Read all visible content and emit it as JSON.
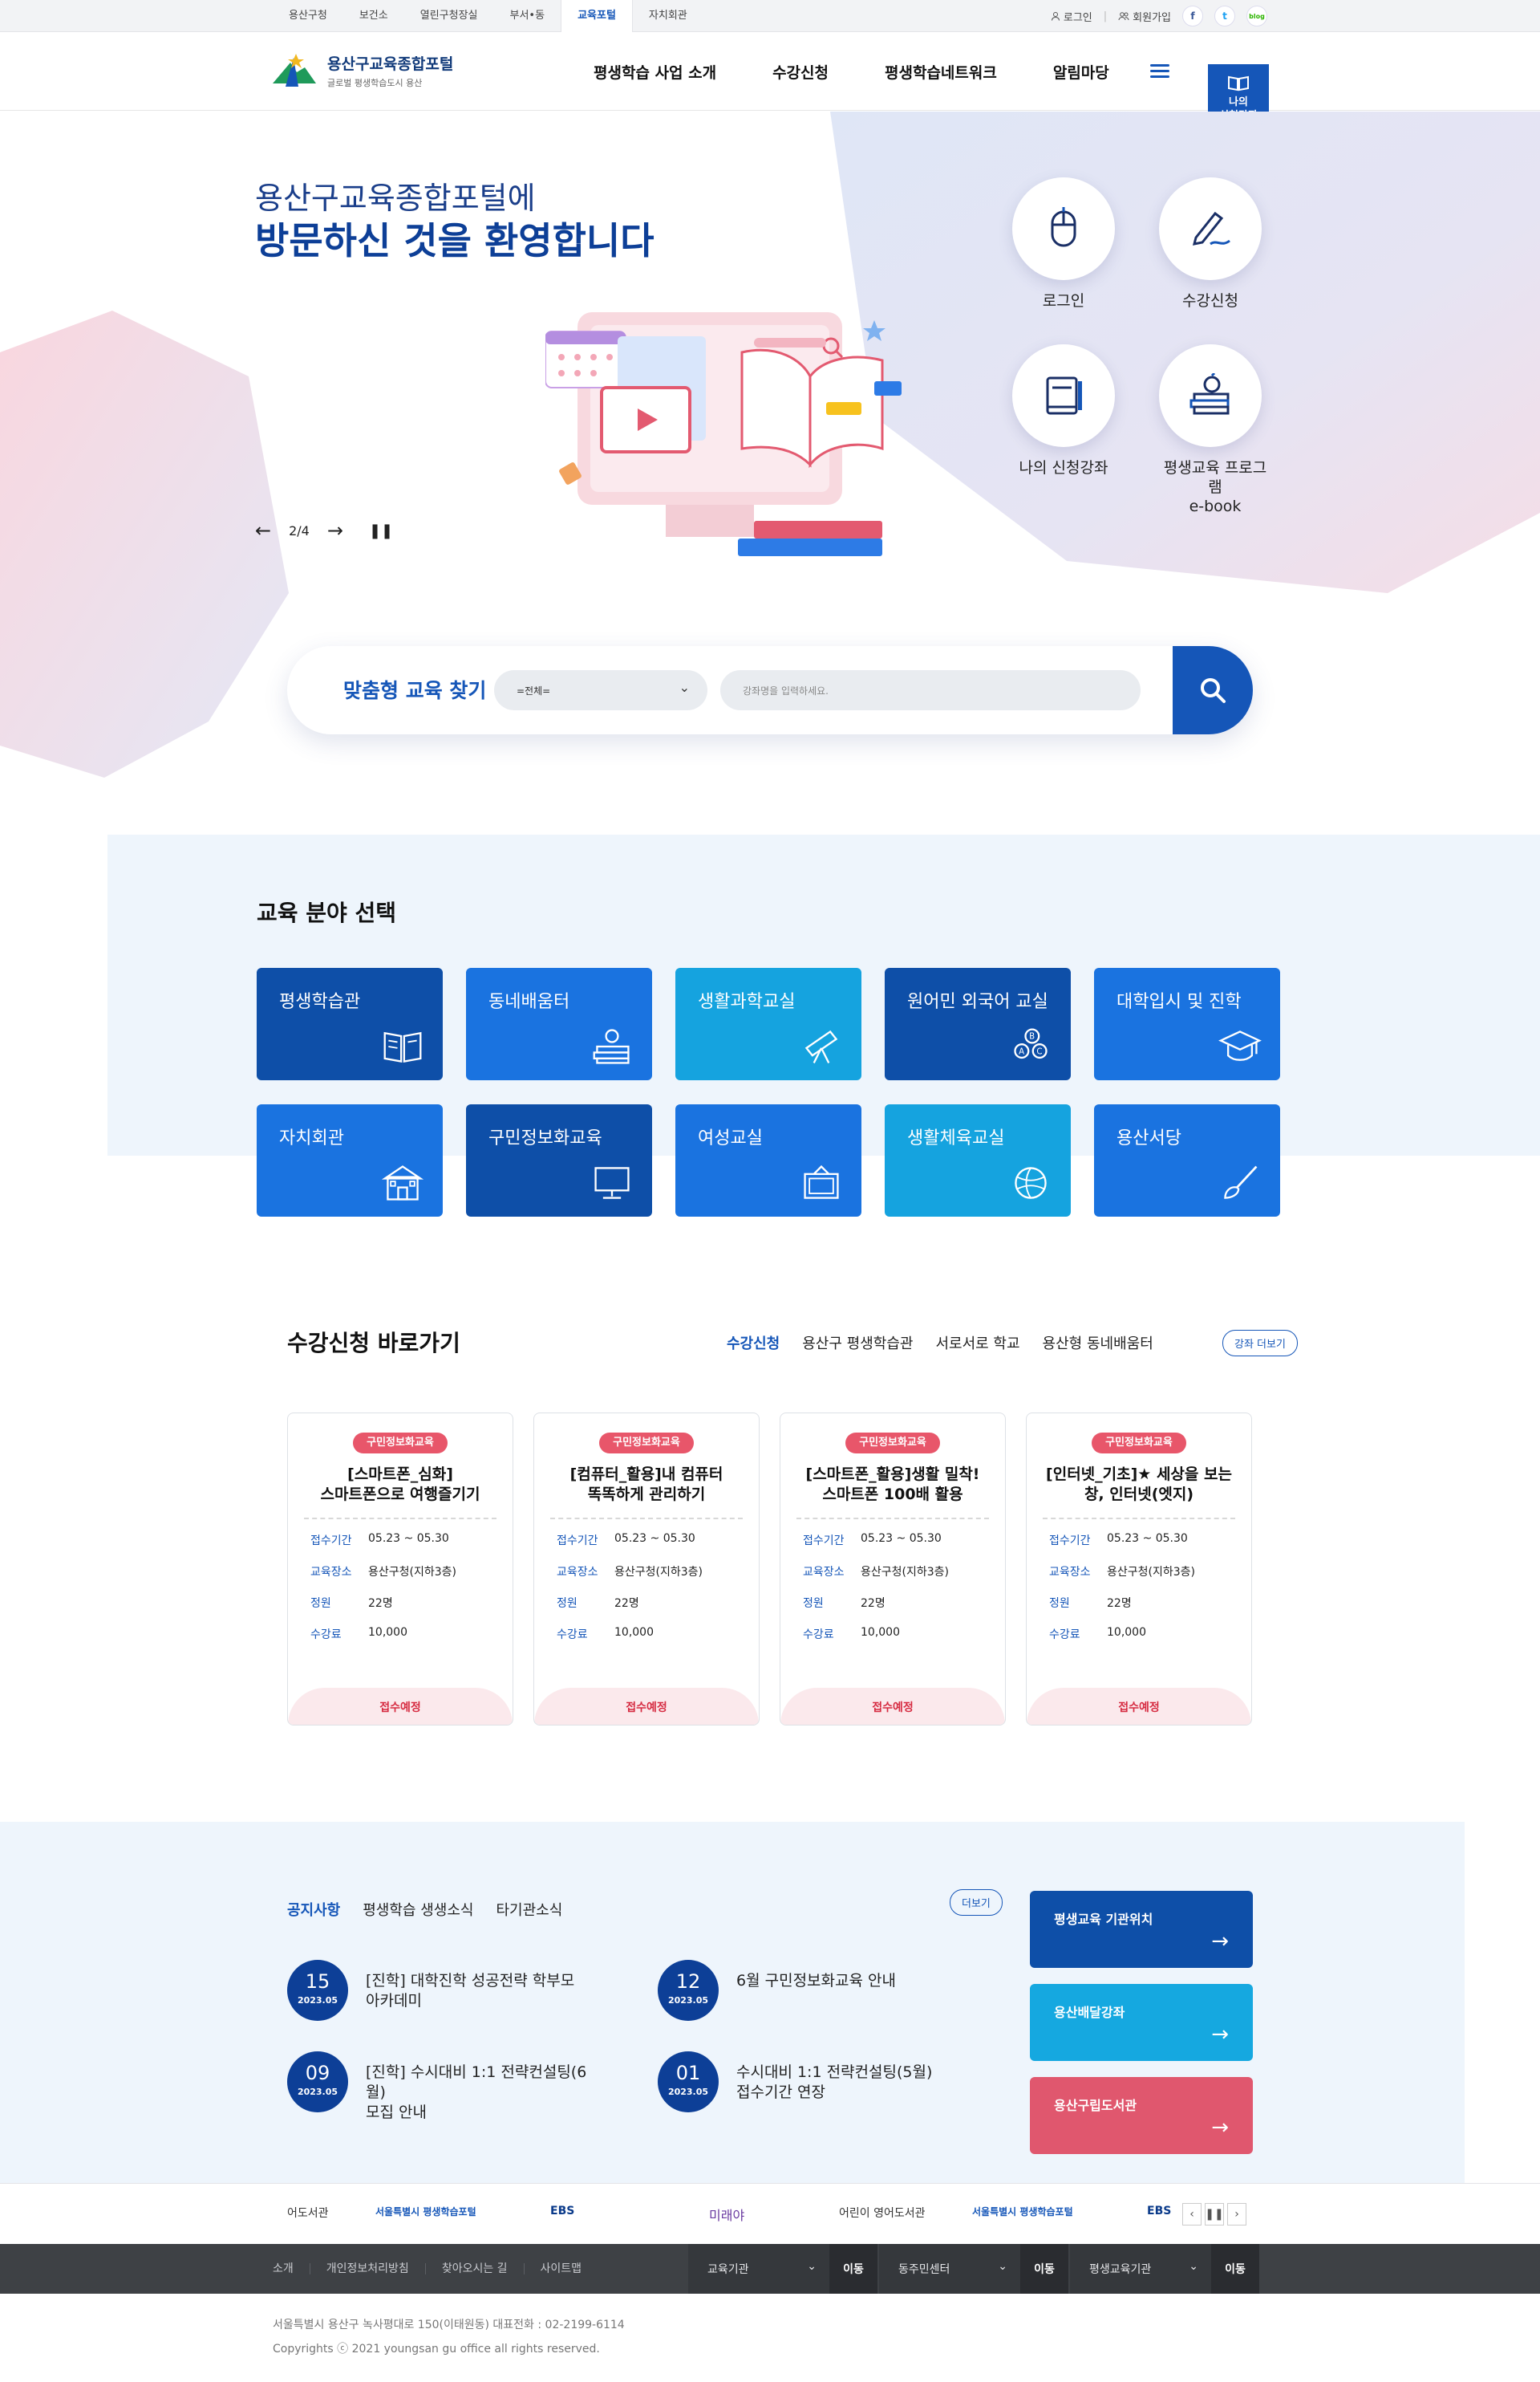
{
  "topbar": {
    "sites": [
      "용산구청",
      "보건소",
      "열린구청장실",
      "부서•동",
      "교육포털",
      "자치회관"
    ],
    "active_site": "교육포털",
    "login": "로그인",
    "join": "회원가입",
    "sns": [
      "facebook-icon",
      "twitter-icon",
      "blog-icon"
    ],
    "sns_text": {
      "facebook": "f",
      "twitter": "t",
      "blog": "blog"
    }
  },
  "header": {
    "logo_title": "용산구교육종합포털",
    "logo_sub": "글로벌 평생학습도시 용산",
    "nav": [
      "평생학습 사업 소개",
      "수강신청",
      "평생학습네트워크",
      "알림마당"
    ],
    "my_class_line1": "나의",
    "my_class_line2": "신청강좌"
  },
  "hero": {
    "title1": "용산구교육종합포털에",
    "title2": "방문하신 것을 환영합니다",
    "slide_counter": "2/4",
    "quick": [
      {
        "label": "로그인",
        "icon": "mouse-icon"
      },
      {
        "label": "수강신청",
        "icon": "pen-icon"
      },
      {
        "label": "나의 신청강좌",
        "icon": "book-icon"
      },
      {
        "label": "평생교육 프로그램",
        "label2": "e-book",
        "icon": "books-apple-icon"
      }
    ]
  },
  "search": {
    "title": "맞춤형 교육 찾기",
    "select_value": "=전체=",
    "placeholder": "강좌명을 입력하세요."
  },
  "field": {
    "title": "교육 분야 선택",
    "items": [
      {
        "label": "평생학습관",
        "color": "#0e4fa8",
        "icon": "open-book-icon"
      },
      {
        "label": "동네배움터",
        "color": "#1a73e0",
        "icon": "apple-books-icon"
      },
      {
        "label": "생활과학교실",
        "color": "#15a3df",
        "icon": "telescope-icon"
      },
      {
        "label": "원어민 외국어 교실",
        "color": "#0e4fa8",
        "icon": "abc-bubbles-icon"
      },
      {
        "label": "대학입시 및 진학",
        "color": "#1a73e0",
        "icon": "graduation-cap-icon"
      },
      {
        "label": "자치회관",
        "color": "#1a73e0",
        "icon": "building-icon"
      },
      {
        "label": "구민정보화교육",
        "color": "#0e4fa8",
        "icon": "monitor-icon"
      },
      {
        "label": "여성교실",
        "color": "#1a73e0",
        "icon": "frame-icon"
      },
      {
        "label": "생활체육교실",
        "color": "#15a3df",
        "icon": "ball-icon"
      },
      {
        "label": "용산서당",
        "color": "#1a73e0",
        "icon": "brush-icon"
      }
    ]
  },
  "apply": {
    "title": "수강신청 바로가기",
    "tabs": [
      "수강신청",
      "용산구 평생학습관",
      "서로서로 학교",
      "용산형 동네배움터"
    ],
    "more": "강좌 더보기",
    "field_labels": [
      "접수기간",
      "교육장소",
      "정원",
      "수강료"
    ],
    "cards": [
      {
        "badge": "구민정보화교육",
        "title1": "[스마트폰_심화]",
        "title2": "스마트폰으로 여행즐기기",
        "period": "05.23 ~ 05.30",
        "place": "용산구청(지하3층)",
        "capacity": "22명",
        "fee": "10,000",
        "status": "접수예정"
      },
      {
        "badge": "구민정보화교육",
        "title1": "[컴퓨터_활용]내 컴퓨터",
        "title2": "똑똑하게 관리하기",
        "period": "05.23 ~ 05.30",
        "place": "용산구청(지하3층)",
        "capacity": "22명",
        "fee": "10,000",
        "status": "접수예정"
      },
      {
        "badge": "구민정보화교육",
        "title1": "[스마트폰_활용]생활 밀착!",
        "title2": "스마트폰 100배 활용",
        "period": "05.23 ~ 05.30",
        "place": "용산구청(지하3층)",
        "capacity": "22명",
        "fee": "10,000",
        "status": "접수예정"
      },
      {
        "badge": "구민정보화교육",
        "title1": "[인터넷_기초]★ 세상을 보는",
        "title2": "창, 인터넷(엣지)",
        "period": "05.23 ~ 05.30",
        "place": "용산구청(지하3층)",
        "capacity": "22명",
        "fee": "10,000",
        "status": "접수예정"
      }
    ]
  },
  "notice": {
    "tabs": [
      "공지사항",
      "평생학습 생생소식",
      "타기관소식"
    ],
    "more": "더보기",
    "items": [
      {
        "day": "15",
        "ym": "2023.05",
        "line1": "[진학] 대학진학 성공전략 학부모",
        "line2": "아카데미"
      },
      {
        "day": "12",
        "ym": "2023.05",
        "line1": "6월 구민정보화교육 안내",
        "line2": ""
      },
      {
        "day": "09",
        "ym": "2023.05",
        "line1": "[진학] 수시대비 1:1 전략컨설팅(6월)",
        "line2": "모집 안내"
      },
      {
        "day": "01",
        "ym": "2023.05",
        "line1": "수시대비 1:1 전략컨설팅(5월)",
        "line2": "접수기간 연장"
      }
    ],
    "links": [
      {
        "label": "평생교육 기관위치",
        "color": "#0e4fa8"
      },
      {
        "label": "용산배달강좌",
        "color": "#15a8e0"
      },
      {
        "label": "용산구립도서관",
        "color": "#e0576e"
      }
    ]
  },
  "partners": {
    "items": [
      "어도서관",
      "서울특별시 평생학습포털",
      "EBS",
      "미래야",
      "어린이 영어도서관",
      "서울특별시 평생학습포털",
      "EBS"
    ]
  },
  "footer": {
    "links": [
      "소개",
      "개인정보처리방침",
      "찾아오시는 길",
      "사이트맵"
    ],
    "selects": [
      "교육기관",
      "동주민센터",
      "평생교육기관"
    ],
    "go": "이동",
    "address": "서울특별시 용산구 녹사평대로 150(이태원동) 대표전화 : 02-2199-6114",
    "copyright": "Copyrights ⓒ 2021 youngsan gu office all rights reserved."
  }
}
